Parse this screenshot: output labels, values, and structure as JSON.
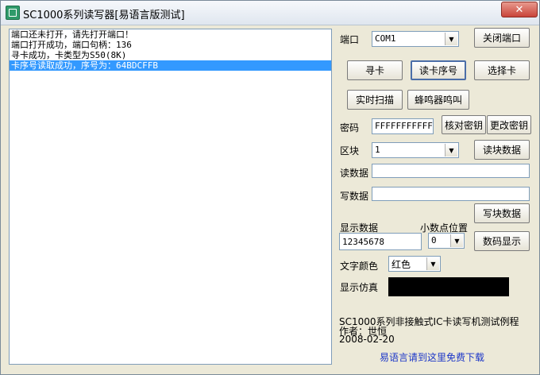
{
  "window": {
    "title": "SC1000系列读写器[易语言版测试]"
  },
  "log": {
    "lines": [
      "端口还未打开，请先打开端口！",
      "端口打开成功，端口句柄：136",
      "寻卡成功，卡类型为S50(8K)",
      "卡序号读取成功，序号为：64BDCFFB"
    ]
  },
  "port": {
    "label": "端口",
    "value": "COM1",
    "close_button": "关闭端口"
  },
  "actions": {
    "find_card": "寻卡",
    "read_serial": "读卡序号",
    "select_card": "选择卡",
    "realtime_scan": "实时扫描",
    "buzzer": "蜂鸣器鸣叫"
  },
  "password": {
    "label": "密码",
    "value": "FFFFFFFFFFFF",
    "verify_button": "核对密钥",
    "change_button": "更改密钥"
  },
  "block": {
    "label": "区块",
    "value": "1",
    "read_button": "读块数据"
  },
  "read_data": {
    "label": "读数据",
    "value": ""
  },
  "write_data": {
    "label": "写数据",
    "value": "",
    "write_button": "写块数据"
  },
  "display": {
    "data_label": "显示数据",
    "data_value": "12345678",
    "decimal_label": "小数点位置",
    "decimal_value": "0",
    "show_button": "数码显示"
  },
  "text_color": {
    "label": "文字颜色",
    "value": "红色"
  },
  "simulate": {
    "label": "显示仿真",
    "color": "#000000"
  },
  "info": {
    "line1": "SC1000系列非接触式IC卡读写机测试例程",
    "line2": "作者：世恒",
    "line3": "2008-02-20"
  },
  "download_link": "易语言请到这里免费下载",
  "colors": {
    "selection": "#3399ff",
    "link": "#1a35c8",
    "close": "#c9443a"
  }
}
